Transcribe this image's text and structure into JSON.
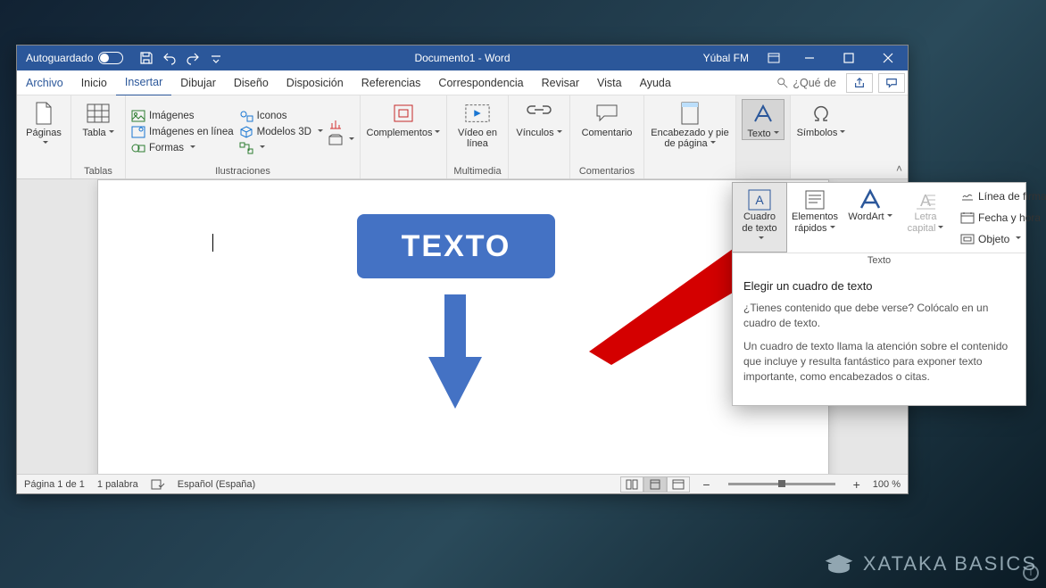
{
  "titlebar": {
    "autosave": "Autoguardado",
    "title": "Documento1  -  Word",
    "user": "Yúbal FM"
  },
  "tabs": {
    "file": "Archivo",
    "items": [
      "Inicio",
      "Insertar",
      "Dibujar",
      "Diseño",
      "Disposición",
      "Referencias",
      "Correspondencia",
      "Revisar",
      "Vista",
      "Ayuda"
    ],
    "active_index": 1,
    "tellme": "¿Qué de"
  },
  "ribbon": {
    "paginas": {
      "btn": "Páginas",
      "label": ""
    },
    "tablas": {
      "btn": "Tabla",
      "label": "Tablas"
    },
    "ilustraciones": {
      "imagenes": "Imágenes",
      "imagenes_en_linea": "Imágenes en línea",
      "formas": "Formas",
      "iconos": "Iconos",
      "modelos3d": "Modelos 3D",
      "label": "Ilustraciones"
    },
    "complementos": {
      "btn": "Complementos",
      "label": ""
    },
    "multimedia": {
      "btn": "Vídeo en línea",
      "label": "Multimedia"
    },
    "vinculos": {
      "btn": "Vínculos",
      "label": ""
    },
    "comentarios": {
      "btn": "Comentario",
      "label": "Comentarios"
    },
    "encabezado": {
      "btn": "Encabezado y pie de página",
      "label": ""
    },
    "texto": {
      "btn": "Texto",
      "label": ""
    },
    "simbolos": {
      "btn": "Símbolos",
      "label": ""
    }
  },
  "document": {
    "textbox_content": "TEXTO"
  },
  "popup": {
    "cuadro": "Cuadro de texto",
    "elementos": "Elementos rápidos",
    "wordart": "WordArt",
    "letra": "Letra capital",
    "linea_firma": "Línea de firma",
    "fecha_hora": "Fecha y hora",
    "objeto": "Objeto",
    "group_label": "Texto",
    "tooltip_title": "Elegir un cuadro de texto",
    "tooltip_p1": "¿Tienes contenido que debe verse? Colócalo en un cuadro de texto.",
    "tooltip_p2": "Un cuadro de texto llama la atención sobre el contenido que incluye y resulta fantástico para exponer texto importante, como encabezados o citas."
  },
  "statusbar": {
    "page": "Página 1 de 1",
    "words": "1 palabra",
    "lang": "Español (España)",
    "zoom": "100 %"
  },
  "watermark": "XATAKA BASICS"
}
